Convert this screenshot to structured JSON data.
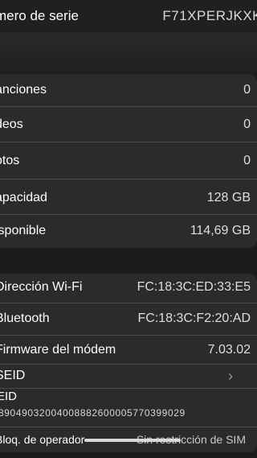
{
  "header": {
    "serial_label": "mero de serie",
    "serial_value": "F71XPERJKXK"
  },
  "stats": [
    {
      "label": "anciones",
      "value": "0"
    },
    {
      "label": "deos",
      "value": "0"
    },
    {
      "label": "otos",
      "value": "0"
    },
    {
      "label": "apacidad",
      "value": "128 GB"
    },
    {
      "label": "isponible",
      "value": "114,69 GB"
    }
  ],
  "network": {
    "wifi_label": "Dirección Wi-Fi",
    "wifi_value": "FC:18:3C:ED:33:E5",
    "bluetooth_label": "Bluetooth",
    "bluetooth_value": "FC:18:3C:F2:20:AD",
    "modem_label": "Firmware del módem",
    "modem_value": "7.03.02",
    "seid_label": "SEID",
    "seid_chevron": "›",
    "eid_label": "EID",
    "eid_value": "89049032004008882600005770399029",
    "carrier_lock_label": "Bloq. de operador",
    "carrier_lock_value": "Sin restricción de SIM"
  }
}
